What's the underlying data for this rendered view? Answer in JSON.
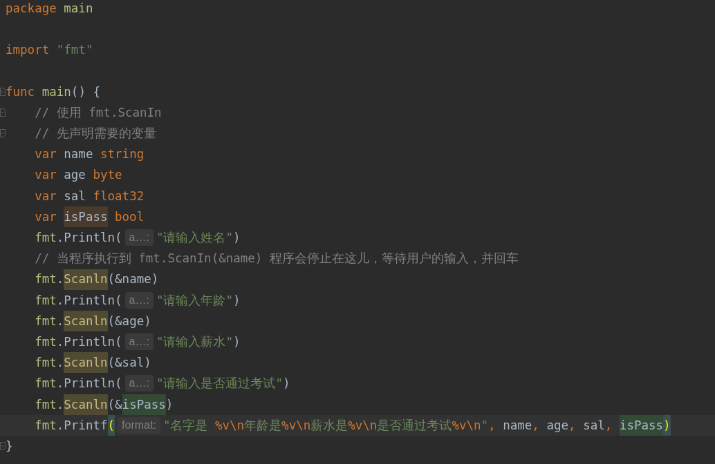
{
  "editor": {
    "lines": [
      {
        "tokens": [
          {
            "kind": "kw",
            "text": "package"
          },
          {
            "kind": "fn",
            "text": " main"
          }
        ]
      },
      {
        "blank": true
      },
      {
        "tokens": [
          {
            "kind": "kw",
            "text": "import"
          },
          {
            "kind": "str",
            "text": " \"fmt\""
          }
        ]
      },
      {
        "blank": true
      },
      {
        "fold_start": true,
        "tokens": [
          {
            "kind": "kw",
            "text": "func"
          },
          {
            "kind": "fn",
            "text": " main"
          },
          {
            "kind": "plain",
            "text": "() {"
          }
        ]
      },
      {
        "fold_start": true,
        "tokens": [
          {
            "kind": "comment",
            "text": "    // 使用 fmt.ScanIn"
          }
        ]
      },
      {
        "fold_end": true,
        "tokens": [
          {
            "kind": "comment",
            "text": "    // 先声明需要的变量"
          }
        ]
      },
      {
        "tokens": [
          {
            "kind": "kw",
            "text": "    var"
          },
          {
            "kind": "ident",
            "text": " name"
          },
          {
            "kind": "kw",
            "text": " string"
          }
        ]
      },
      {
        "tokens": [
          {
            "kind": "kw",
            "text": "    var"
          },
          {
            "kind": "ident",
            "text": " age"
          },
          {
            "kind": "kw",
            "text": " byte"
          }
        ]
      },
      {
        "tokens": [
          {
            "kind": "kw",
            "text": "    var"
          },
          {
            "kind": "ident",
            "text": " sal"
          },
          {
            "kind": "kw",
            "text": " float32"
          }
        ]
      },
      {
        "tokens": [
          {
            "kind": "kw",
            "text": "    var "
          },
          {
            "kind": "ident",
            "text": "isPass",
            "read_usage": true
          },
          {
            "kind": "kw",
            "text": " bool"
          }
        ]
      },
      {
        "tokens": [
          {
            "kind": "fn",
            "text": "    fmt"
          },
          {
            "kind": "plain",
            "text": ".Println("
          },
          {
            "kind": "hint",
            "text": "a…:"
          },
          {
            "kind": "str",
            "text": "\"请输入姓名\""
          },
          {
            "kind": "plain",
            "text": ")"
          }
        ]
      },
      {
        "tokens": [
          {
            "kind": "comment",
            "text": "    // 当程序执行到 fmt.ScanIn(&name) 程序会停止在这儿，等待用户的输入，并回车"
          }
        ]
      },
      {
        "tokens": [
          {
            "kind": "fn",
            "text": "    fmt"
          },
          {
            "kind": "plain",
            "text": "."
          },
          {
            "kind": "method",
            "text": "Scanln",
            "search_match": true
          },
          {
            "kind": "plain",
            "text": "(&"
          },
          {
            "kind": "ident",
            "text": "name"
          },
          {
            "kind": "plain",
            "text": ")"
          }
        ]
      },
      {
        "tokens": [
          {
            "kind": "fn",
            "text": "    fmt"
          },
          {
            "kind": "plain",
            "text": ".Println("
          },
          {
            "kind": "hint",
            "text": "a…:"
          },
          {
            "kind": "str",
            "text": "\"请输入年龄\""
          },
          {
            "kind": "plain",
            "text": ")"
          }
        ]
      },
      {
        "tokens": [
          {
            "kind": "fn",
            "text": "    fmt"
          },
          {
            "kind": "plain",
            "text": "."
          },
          {
            "kind": "method",
            "text": "Scanln",
            "search_match": true
          },
          {
            "kind": "plain",
            "text": "(&"
          },
          {
            "kind": "ident",
            "text": "age"
          },
          {
            "kind": "plain",
            "text": ")"
          }
        ]
      },
      {
        "tokens": [
          {
            "kind": "fn",
            "text": "    fmt"
          },
          {
            "kind": "plain",
            "text": ".Println("
          },
          {
            "kind": "hint",
            "text": "a…:"
          },
          {
            "kind": "str",
            "text": "\"请输入薪水\""
          },
          {
            "kind": "plain",
            "text": ")"
          }
        ]
      },
      {
        "tokens": [
          {
            "kind": "fn",
            "text": "    fmt"
          },
          {
            "kind": "plain",
            "text": "."
          },
          {
            "kind": "method",
            "text": "Scanln",
            "search_match": true
          },
          {
            "kind": "plain",
            "text": "(&"
          },
          {
            "kind": "ident",
            "text": "sal"
          },
          {
            "kind": "plain",
            "text": ")"
          }
        ]
      },
      {
        "tokens": [
          {
            "kind": "fn",
            "text": "    fmt"
          },
          {
            "kind": "plain",
            "text": ".Println("
          },
          {
            "kind": "hint",
            "text": "a…:"
          },
          {
            "kind": "str",
            "text": "\"请输入是否通过考试\""
          },
          {
            "kind": "plain",
            "text": ")"
          }
        ]
      },
      {
        "tokens": [
          {
            "kind": "fn",
            "text": "    fmt"
          },
          {
            "kind": "plain",
            "text": "."
          },
          {
            "kind": "method",
            "text": "Scanln",
            "search_match": true
          },
          {
            "kind": "plain",
            "text": "(&"
          },
          {
            "kind": "ident",
            "text": "isPass",
            "write_usage": true
          },
          {
            "kind": "plain",
            "text": ")"
          }
        ]
      },
      {
        "current": true,
        "tokens": [
          {
            "kind": "fn",
            "text": "    fmt"
          },
          {
            "kind": "plain",
            "text": ".Printf"
          },
          {
            "kind": "plain",
            "text": "(",
            "bracket_match": true
          },
          {
            "kind": "hint",
            "text": "format:"
          },
          {
            "kind": "str",
            "text": "\"名字是 "
          },
          {
            "kind": "kw",
            "text": "%v\\n"
          },
          {
            "kind": "str",
            "text": "年龄是"
          },
          {
            "kind": "kw",
            "text": "%v\\n"
          },
          {
            "kind": "str",
            "text": "薪水是"
          },
          {
            "kind": "kw",
            "text": "%v\\n"
          },
          {
            "kind": "str",
            "text": "是否通过考试"
          },
          {
            "kind": "kw",
            "text": "%v\\n"
          },
          {
            "kind": "str",
            "text": "\""
          },
          {
            "kind": "kw",
            "text": ","
          },
          {
            "kind": "ident",
            "text": " name"
          },
          {
            "kind": "kw",
            "text": ","
          },
          {
            "kind": "ident",
            "text": " age"
          },
          {
            "kind": "kw",
            "text": ","
          },
          {
            "kind": "ident",
            "text": " sal"
          },
          {
            "kind": "kw",
            "text": ", "
          },
          {
            "kind": "ident",
            "text": "isPass",
            "write_usage": true
          },
          {
            "kind": "plain",
            "text": ")",
            "bracket_match": true
          }
        ]
      },
      {
        "fold_end": true,
        "tokens": [
          {
            "kind": "plain",
            "text": "}"
          }
        ]
      }
    ]
  }
}
